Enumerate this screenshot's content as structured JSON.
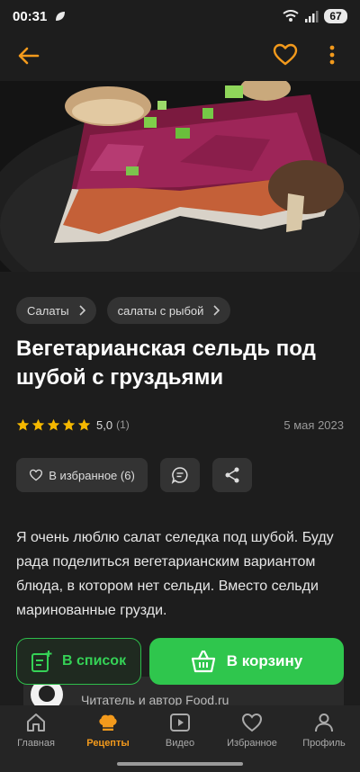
{
  "status_bar": {
    "time": "00:31",
    "battery": "67"
  },
  "app_bar": {
    "icons": [
      "back-arrow-icon",
      "heart-icon",
      "more-vert-icon"
    ],
    "accent": "#f39a1c"
  },
  "breadcrumbs": [
    {
      "label": "Салаты"
    },
    {
      "label": "салаты с рыбой"
    }
  ],
  "recipe": {
    "title": "Вегетарианская сельдь под шубой с груздьями",
    "rating": {
      "stars": 5,
      "value": "5,0",
      "count": "(1)"
    },
    "date": "5 мая 2023",
    "favorite_label": "В избранное (6)",
    "description": "Я очень люблю салат селедка под шубой. Буду рада поделиться вегетарианским вариантом блюда, в котором нет сельди. Вместо сельди маринованные грузди."
  },
  "author": {
    "text": "Читатель и автор Food.ru"
  },
  "cta": {
    "list_label": "В список",
    "cart_label": "В корзину",
    "green": "#2fc64d"
  },
  "bottom_nav": [
    {
      "label": "Главная",
      "icon": "home-icon"
    },
    {
      "label": "Рецепты",
      "icon": "chef-hat-icon",
      "active": true
    },
    {
      "label": "Видео",
      "icon": "video-icon"
    },
    {
      "label": "Избранное",
      "icon": "heart-icon"
    },
    {
      "label": "Профиль",
      "icon": "profile-icon"
    }
  ]
}
